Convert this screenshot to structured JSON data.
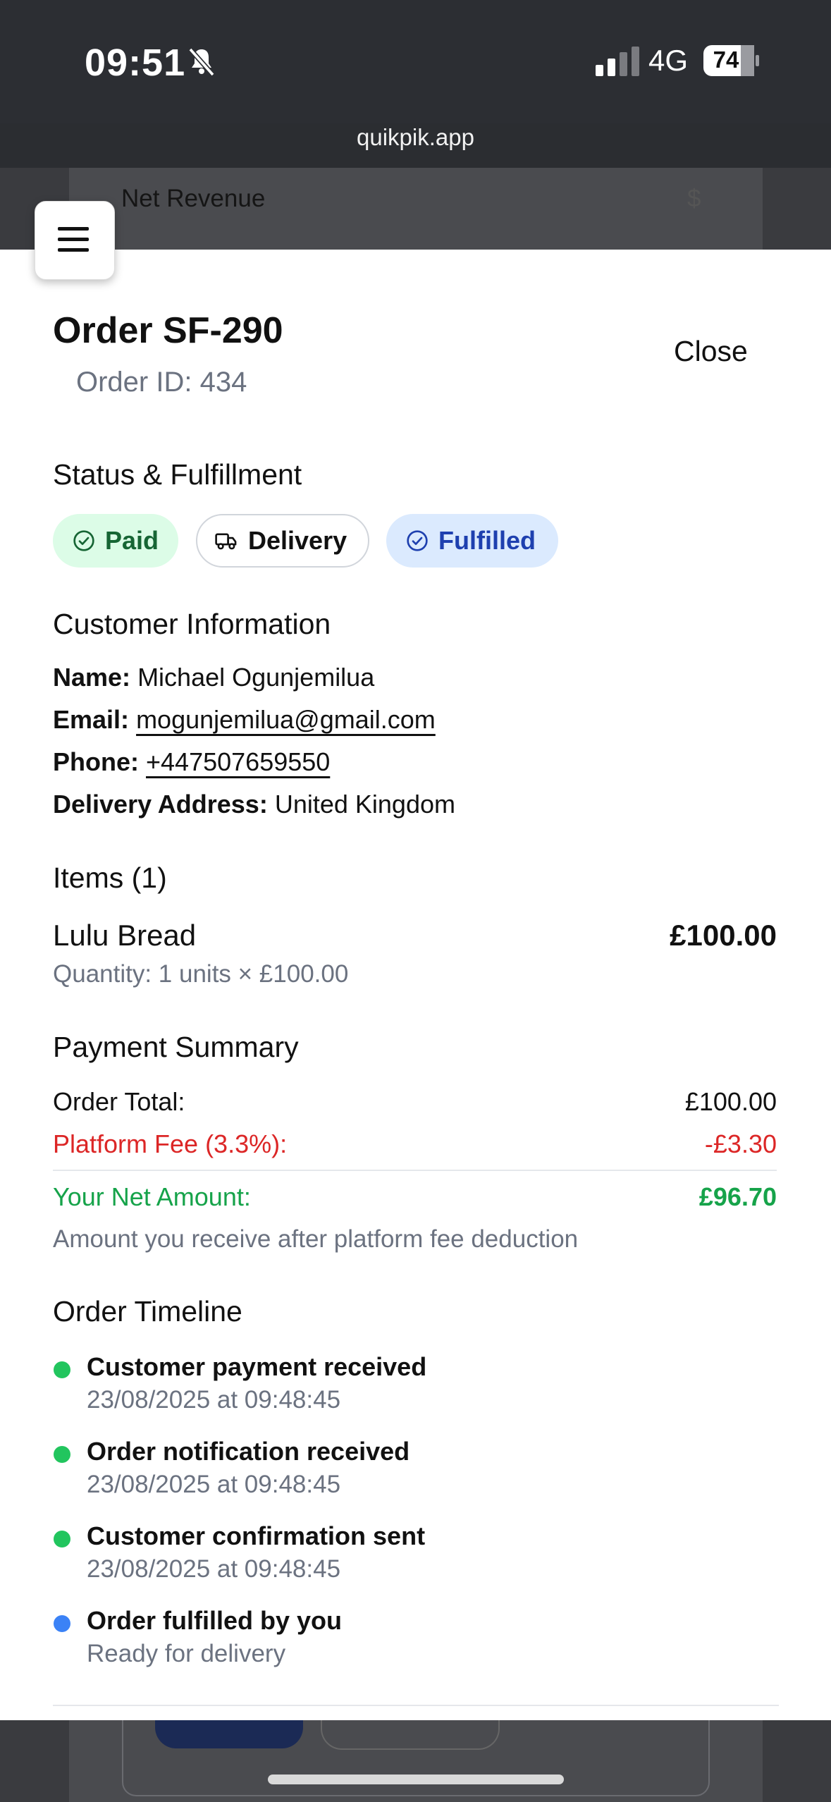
{
  "status_bar": {
    "time": "09:51",
    "network": "4G",
    "battery": "74"
  },
  "browser": {
    "url": "quikpik.app"
  },
  "background": {
    "card_label": "Net Revenue",
    "card_symbol": "$"
  },
  "order": {
    "title": "Order SF-290",
    "order_id": "Order ID: 434",
    "close_label": "Close"
  },
  "status": {
    "heading": "Status & Fulfillment",
    "badges": [
      "Paid",
      "Delivery",
      "Fulfilled"
    ]
  },
  "customer": {
    "heading": "Customer Information",
    "name_label": "Name:",
    "name": "Michael Ogunjemilua",
    "email_label": "Email:",
    "email": "mogunjemilua@gmail.com",
    "phone_label": "Phone:",
    "phone": "+447507659550",
    "address_label": "Delivery Address:",
    "address": "United Kingdom"
  },
  "items": {
    "heading": "Items (1)",
    "list": [
      {
        "name": "Lulu Bread",
        "price": "£100.00",
        "quantity": "Quantity: 1 units × £100.00"
      }
    ]
  },
  "payment": {
    "heading": "Payment Summary",
    "total_label": "Order Total:",
    "total": "£100.00",
    "fee_label": "Platform Fee (3.3%):",
    "fee": "-£3.30",
    "net_label": "Your Net Amount:",
    "net": "£96.70",
    "note": "Amount you receive after platform fee deduction"
  },
  "timeline": {
    "heading": "Order Timeline",
    "events": [
      {
        "title": "Customer payment received",
        "sub": "23/08/2025 at 09:48:45",
        "color": "#22c55e"
      },
      {
        "title": "Order notification received",
        "sub": "23/08/2025 at 09:48:45",
        "color": "#22c55e"
      },
      {
        "title": "Customer confirmation sent",
        "sub": "23/08/2025 at 09:48:45",
        "color": "#22c55e"
      },
      {
        "title": "Order fulfilled by you",
        "sub": "Ready for delivery",
        "color": "#3b82f6"
      }
    ]
  }
}
